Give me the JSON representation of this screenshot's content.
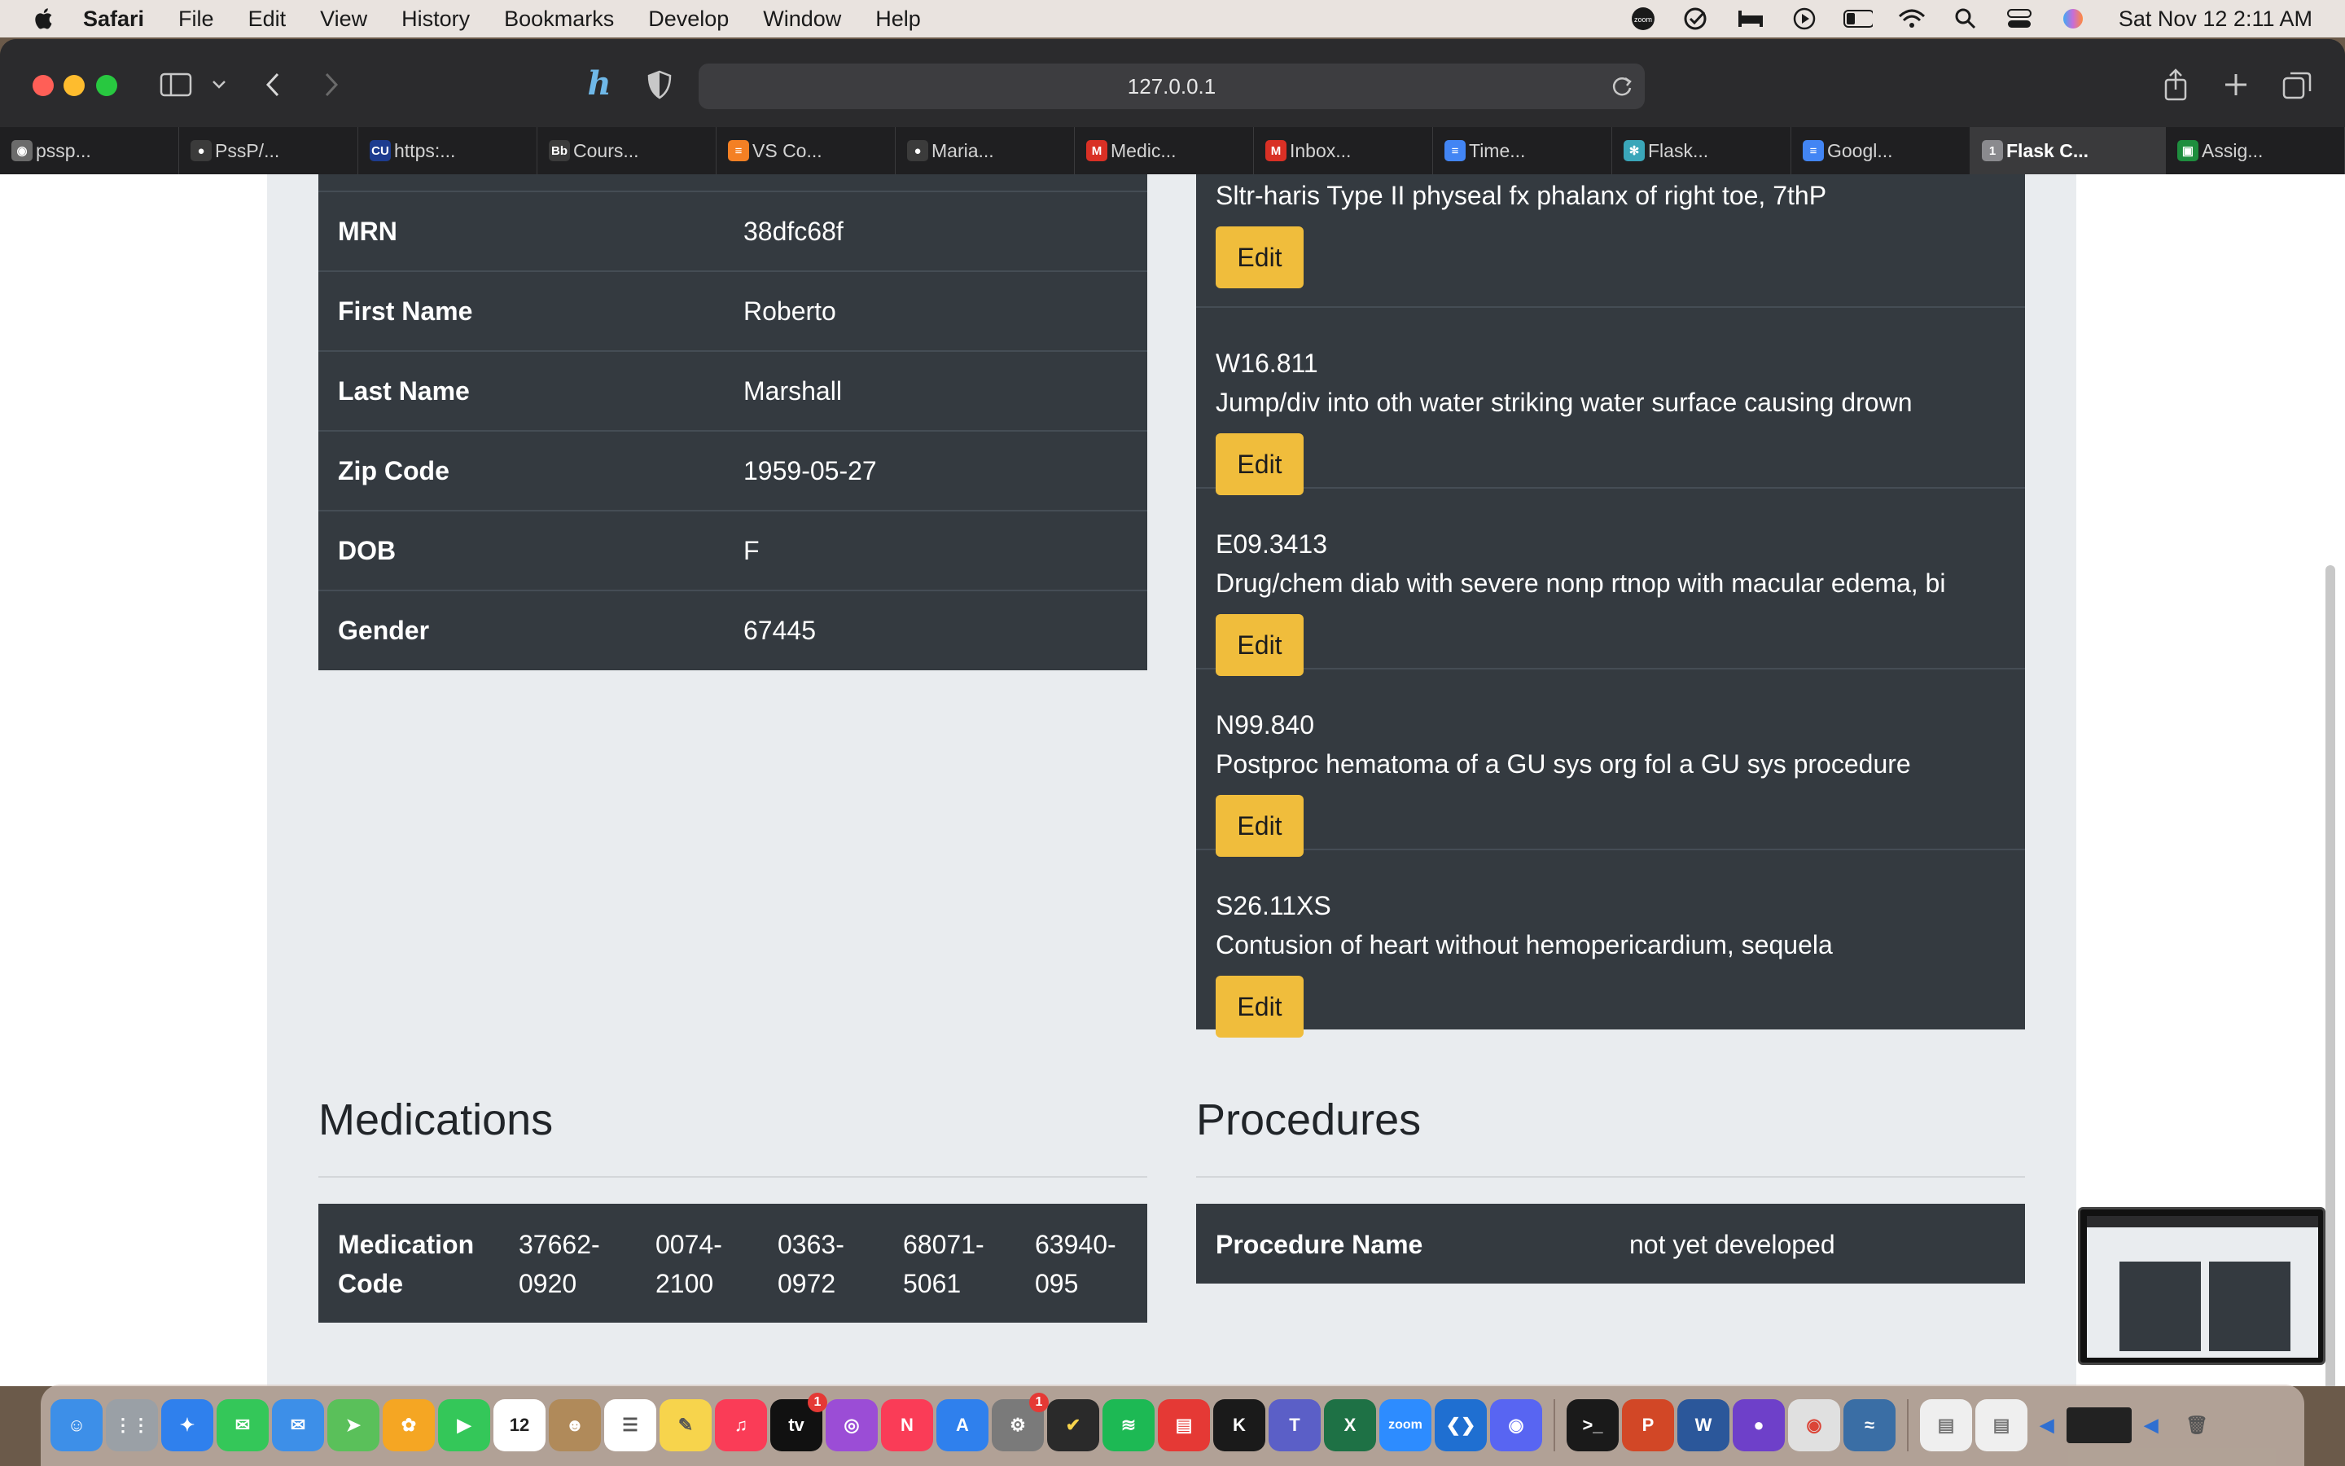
{
  "menubar": {
    "app": "Safari",
    "items": [
      "File",
      "Edit",
      "View",
      "History",
      "Bookmarks",
      "Develop",
      "Window",
      "Help"
    ],
    "clock": "Sat Nov 12  2:11 AM",
    "status_icons": [
      "zoom-icon",
      "checklist-icon",
      "bed-icon",
      "play-icon",
      "battery-icon",
      "wifi-icon",
      "search-icon",
      "control-center-icon",
      "siri-icon"
    ]
  },
  "browser": {
    "url": "127.0.0.1",
    "tabs": [
      {
        "label": "pssp...",
        "icon": "chrome",
        "color": "#6b6b6b",
        "glyph": "◉"
      },
      {
        "label": "PssP/...",
        "icon": "github",
        "color": "#3b3b3b",
        "glyph": "●"
      },
      {
        "label": "https:...",
        "icon": "cuny",
        "color": "#1d3c8f",
        "glyph": "CU"
      },
      {
        "label": "Cours...",
        "icon": "blackboard",
        "color": "#3b3b3b",
        "glyph": "Bb"
      },
      {
        "label": "VS Co...",
        "icon": "stackoverflow",
        "color": "#f48024",
        "glyph": "≡"
      },
      {
        "label": "Maria...",
        "icon": "github",
        "color": "#3b3b3b",
        "glyph": "●"
      },
      {
        "label": "Medic...",
        "icon": "gmail",
        "color": "#d93025",
        "glyph": "M"
      },
      {
        "label": "Inbox...",
        "icon": "gmail",
        "color": "#d93025",
        "glyph": "M"
      },
      {
        "label": "Time...",
        "icon": "google-docs",
        "color": "#4285f4",
        "glyph": "≡"
      },
      {
        "label": "Flask...",
        "icon": "flask",
        "color": "#3aa6b9",
        "glyph": "✻"
      },
      {
        "label": "Googl...",
        "icon": "google-docs",
        "color": "#4285f4",
        "glyph": "≡"
      },
      {
        "label": "Flask C...",
        "icon": "number-1",
        "color": "#8a8a8e",
        "glyph": "1",
        "active": true
      },
      {
        "label": "Assig...",
        "icon": "classroom",
        "color": "#1e8e3e",
        "glyph": "▣"
      }
    ]
  },
  "demographics": {
    "rows": [
      {
        "label": "MRN",
        "value": "38dfc68f"
      },
      {
        "label": "First Name",
        "value": "Roberto"
      },
      {
        "label": "Last Name",
        "value": "Marshall"
      },
      {
        "label": "Zip Code",
        "value": "1959-05-27"
      },
      {
        "label": "DOB",
        "value": "F"
      },
      {
        "label": "Gender",
        "value": "67445"
      }
    ]
  },
  "conditions": {
    "edit_label": "Edit",
    "items": [
      {
        "code": "",
        "description": "Sltr-haris Type II physeal fx phalanx of right toe, 7thP"
      },
      {
        "code": "W16.811",
        "description": "Jump/div into oth water striking water surface causing drown"
      },
      {
        "code": "E09.3413",
        "description": "Drug/chem diab with severe nonp rtnop with macular edema, bi"
      },
      {
        "code": "N99.840",
        "description": "Postproc hematoma of a GU sys org fol a GU sys procedure"
      },
      {
        "code": "S26.11XS",
        "description": "Contusion of heart without hemopericardium, sequela"
      }
    ]
  },
  "medications": {
    "title": "Medications",
    "header_line1": "Medication",
    "header_line2": "Code",
    "codes": [
      {
        "l1": "37662-",
        "l2": "0920"
      },
      {
        "l1": "0074-",
        "l2": "2100"
      },
      {
        "l1": "0363-",
        "l2": "0972"
      },
      {
        "l1": "68071-",
        "l2": "5061"
      },
      {
        "l1": "63940-",
        "l2": "095"
      }
    ]
  },
  "procedures": {
    "title": "Procedures",
    "header": "Procedure Name",
    "value": "not yet developed"
  },
  "dock": {
    "apps": [
      {
        "name": "finder",
        "color": "#3d8fe8",
        "glyph": "☺"
      },
      {
        "name": "launchpad",
        "color": "#9aa0a6",
        "glyph": "⋮⋮"
      },
      {
        "name": "safari",
        "color": "#2f80ed",
        "glyph": "✦"
      },
      {
        "name": "messages",
        "color": "#34c759",
        "glyph": "✉"
      },
      {
        "name": "mail",
        "color": "#3d8fe8",
        "glyph": "✉"
      },
      {
        "name": "maps",
        "color": "#5ac05a",
        "glyph": "➤"
      },
      {
        "name": "photos",
        "color": "#f5a623",
        "glyph": "✿"
      },
      {
        "name": "facetime",
        "color": "#34c759",
        "glyph": "▶"
      },
      {
        "name": "calendar",
        "color": "#ffffff",
        "glyph": "12"
      },
      {
        "name": "contacts",
        "color": "#b08a5a",
        "glyph": "☻"
      },
      {
        "name": "reminders",
        "color": "#ffffff",
        "glyph": "☰"
      },
      {
        "name": "notes",
        "color": "#f7d44c",
        "glyph": "✎"
      },
      {
        "name": "music",
        "color": "#fa3c57",
        "glyph": "♫"
      },
      {
        "name": "apple-tv",
        "color": "#111111",
        "glyph": "tv",
        "badge": "1"
      },
      {
        "name": "podcasts",
        "color": "#9b4dd6",
        "glyph": "◎"
      },
      {
        "name": "news",
        "color": "#fa3c57",
        "glyph": "N"
      },
      {
        "name": "app-store",
        "color": "#2f80ed",
        "glyph": "A"
      },
      {
        "name": "system-preferences",
        "color": "#7a7a7a",
        "glyph": "⚙",
        "badge": "1"
      },
      {
        "name": "todo",
        "color": "#2a2a2a",
        "glyph": "✔"
      },
      {
        "name": "spotify",
        "color": "#1db954",
        "glyph": "≋"
      },
      {
        "name": "flashcards",
        "color": "#e53935",
        "glyph": "▤"
      },
      {
        "name": "kindle",
        "color": "#1a1a1a",
        "glyph": "K"
      },
      {
        "name": "teams",
        "color": "#5b5fc7",
        "glyph": "T"
      },
      {
        "name": "excel",
        "color": "#1e7145",
        "glyph": "X"
      },
      {
        "name": "zoom",
        "color": "#2d8cff",
        "glyph": "zoom"
      },
      {
        "name": "vscode",
        "color": "#1f6fd1",
        "glyph": "❮❯"
      },
      {
        "name": "discord",
        "color": "#5865f2",
        "glyph": "◉"
      },
      {
        "name": "terminal",
        "color": "#1a1a1a",
        "glyph": ">_"
      },
      {
        "name": "powerpoint",
        "color": "#d24726",
        "glyph": "P"
      },
      {
        "name": "word",
        "color": "#2b579a",
        "glyph": "W"
      },
      {
        "name": "github-desktop",
        "color": "#6e40c9",
        "glyph": "●"
      },
      {
        "name": "chrome",
        "color": "#e0e0e0",
        "glyph": "◉"
      },
      {
        "name": "mysql-workbench",
        "color": "#3a6ea5",
        "glyph": "≈"
      }
    ]
  }
}
